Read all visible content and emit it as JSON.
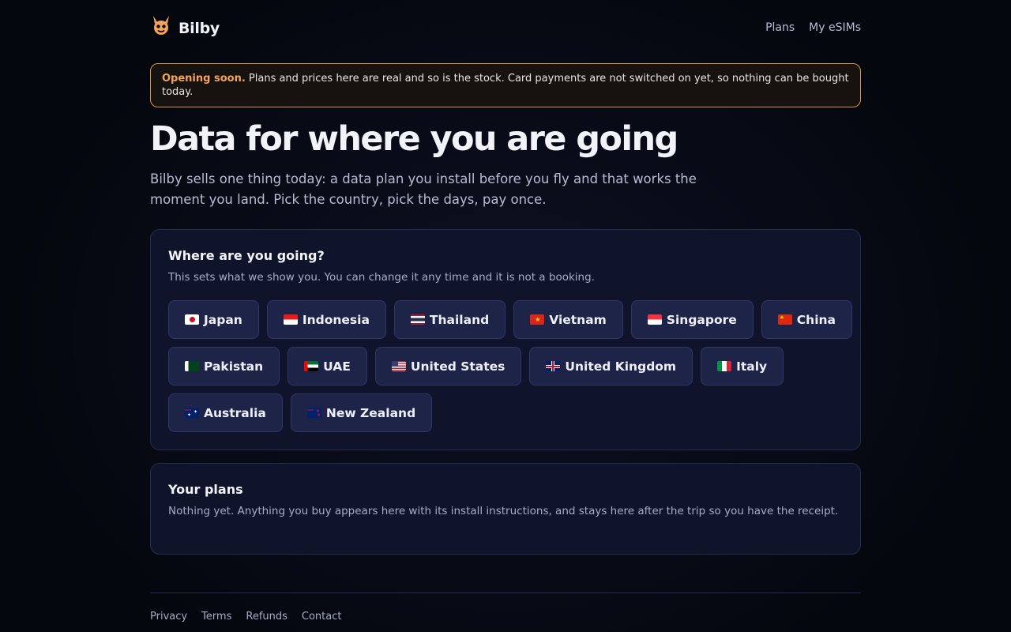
{
  "brand": {
    "name": "Bilby"
  },
  "nav": {
    "plans": "Plans",
    "my_esims": "My eSIMs"
  },
  "notice": {
    "label": "Opening soon.",
    "text": "Plans and prices here are real and so is the stock. Card payments are not switched on yet, so nothing can be bought today."
  },
  "hero": {
    "title": "Data for where you are going",
    "subtitle": "Bilby sells one thing today: a data plan you install before you fly and that works the moment you land. Pick the country, pick the days, pay once."
  },
  "destination": {
    "title": "Where are you going?",
    "help": "This sets what we show you. You can change it any time and it is not a booking.",
    "countries": [
      {
        "name": "Japan",
        "flag": "jp"
      },
      {
        "name": "Indonesia",
        "flag": "id"
      },
      {
        "name": "Thailand",
        "flag": "th"
      },
      {
        "name": "Vietnam",
        "flag": "vn"
      },
      {
        "name": "Singapore",
        "flag": "sg"
      },
      {
        "name": "China",
        "flag": "cn"
      },
      {
        "name": "Pakistan",
        "flag": "pk"
      },
      {
        "name": "UAE",
        "flag": "ae"
      },
      {
        "name": "United States",
        "flag": "us"
      },
      {
        "name": "United Kingdom",
        "flag": "gb"
      },
      {
        "name": "Italy",
        "flag": "it"
      },
      {
        "name": "Australia",
        "flag": "au"
      },
      {
        "name": "New Zealand",
        "flag": "nz"
      }
    ]
  },
  "plans": {
    "title": "Your plans",
    "text": "Nothing yet. Anything you buy appears here with its install instructions, and stays here after the trip so you have the receipt."
  },
  "footer": {
    "privacy": "Privacy",
    "terms": "Terms",
    "refunds": "Refunds",
    "contact": "Contact"
  },
  "colors": {
    "accent": "#f3a45a",
    "card": "#10142b",
    "chip": "#1e2448",
    "background": "#05070f"
  }
}
